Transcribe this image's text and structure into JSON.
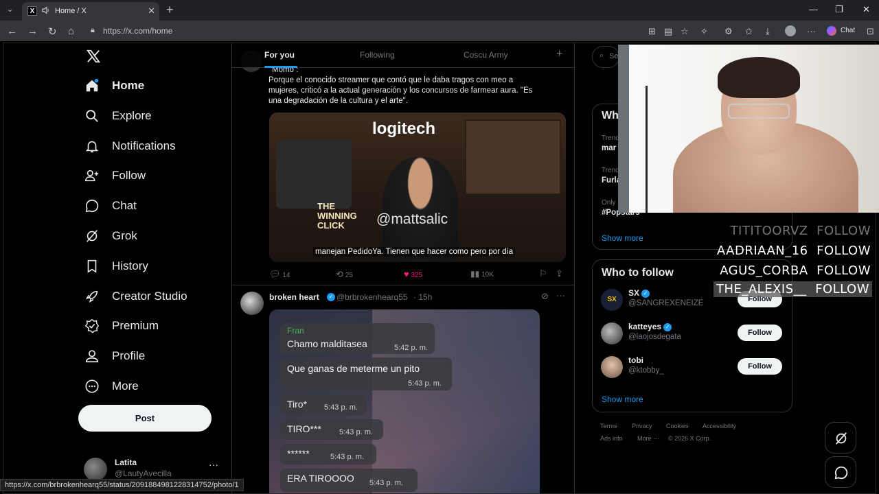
{
  "browser": {
    "tab_title": "Home / X",
    "url": "https://x.com/home",
    "chat_label": "Chat",
    "status_url": "https://x.com/brbrokenhearq55/status/2091884981228314752/photo/1"
  },
  "nav": {
    "items": [
      "Home",
      "Explore",
      "Notifications",
      "Follow",
      "Chat",
      "Grok",
      "History",
      "Creator Studio",
      "Premium",
      "Profile",
      "More"
    ],
    "post_label": "Post",
    "user_name": "Latita",
    "user_handle": "@LautyAvecilla"
  },
  "feed_tabs": [
    "For you",
    "Following",
    "Coscu Army"
  ],
  "tweet1": {
    "quote_label": "Momo :",
    "text_lines": [
      "Porque el conocido streamer que contó que le daba tragos con meo a",
      "mujeres, criticó a la actual generación y los concursos de farmear aura. \"Es",
      "una degradación de la cultura y el arte\"."
    ],
    "media_brand": "logitech",
    "media_watermark": "@mattsalic",
    "media_subtitle": "manejan PedidoYa. Tienen que hacer como pero por día",
    "media_sign": "THE WINNING CLICK",
    "replies": "14",
    "reposts": "25",
    "likes": "325",
    "views": "10K"
  },
  "tweet2": {
    "name": "broken heart",
    "handle": "@brbrokenhearq55",
    "time": "· 15h",
    "messages": [
      {
        "sender": "Fran",
        "text": "Chamo malditasea",
        "time": "5:42 p. m."
      },
      {
        "text": "Que ganas de meterme un pito",
        "time": "5:43 p. m."
      },
      {
        "text": "Tiro*",
        "time": "5:43 p. m."
      },
      {
        "text": "TIRO***",
        "time": "5:43 p. m."
      },
      {
        "text": "******",
        "time": "5:43 p. m."
      },
      {
        "text": "ERA TIROOOO",
        "time": "5:43 p. m."
      }
    ]
  },
  "right": {
    "search_placeholder": "Se",
    "trends_title": "Wh",
    "trends": [
      {
        "context": "Trend",
        "name": "mar"
      },
      {
        "context": "Trend",
        "name": "Furla"
      },
      {
        "context": "Only",
        "name": "#Popstars"
      }
    ],
    "trends_show_more": "Show more",
    "who_to_follow_title": "Who to follow",
    "suggestions": [
      {
        "name": "SX",
        "handle": "@SANGREXENEIZE",
        "verified": true,
        "button": "Follow"
      },
      {
        "name": "katteyes",
        "handle": "@laojosdegata",
        "verified": true,
        "button": "Follow"
      },
      {
        "name": "tobi",
        "handle": "@ktobby_",
        "verified": false,
        "button": "Follow"
      }
    ],
    "wtf_show_more": "Show more",
    "footer": [
      "Terms",
      "Privacy",
      "Cookies",
      "Accessibility",
      "Ads info",
      "More ···",
      "© 2026 X Corp."
    ]
  },
  "stream_overlay": {
    "follows": [
      {
        "user": "TITITOORVZ",
        "action": "FOLLOW"
      },
      {
        "user": "AADRIAAN_16",
        "action": "FOLLOW"
      },
      {
        "user": "AGUS_CORBA",
        "action": "FOLLOW"
      },
      {
        "user": "THE_ALEXIS__",
        "action": "FOLLOW"
      }
    ]
  },
  "colors": {
    "accent": "#1d9bf0",
    "like": "#f91880",
    "message_sender": "#4caf50"
  }
}
